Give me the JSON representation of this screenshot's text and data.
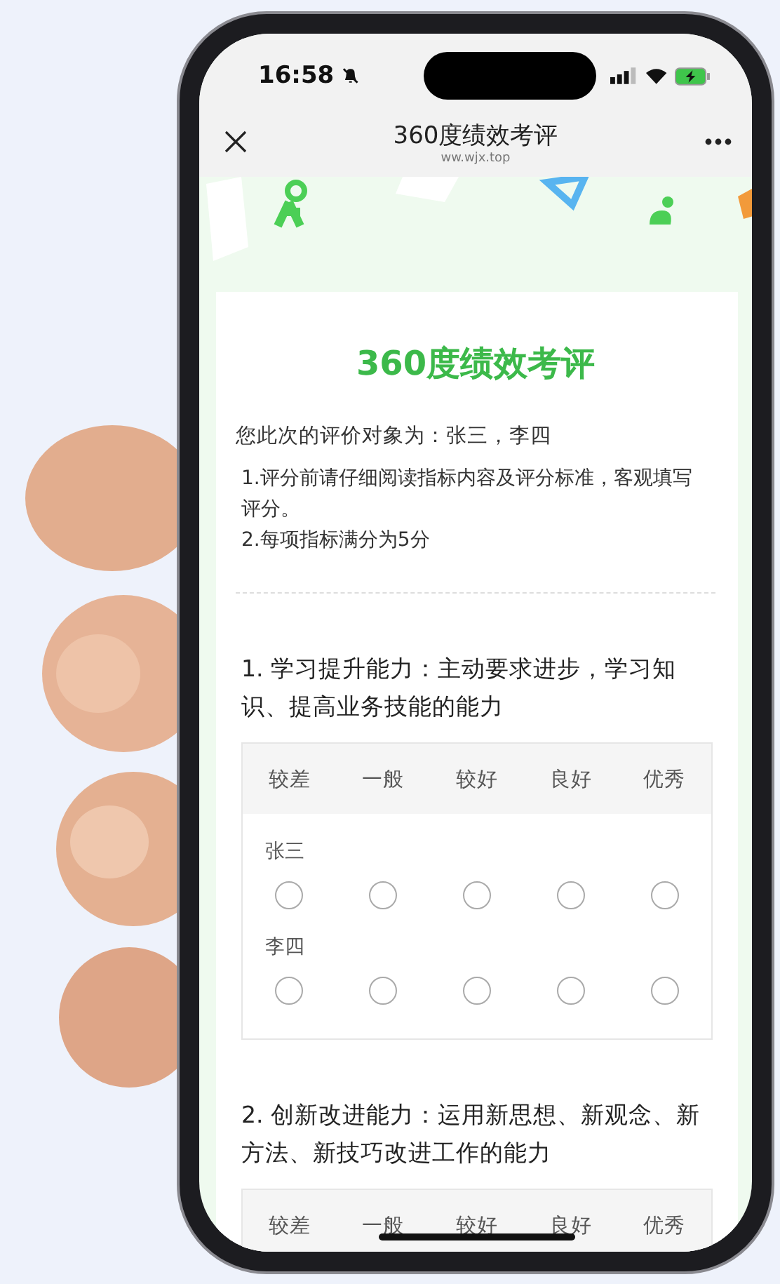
{
  "status_bar": {
    "time": "16:58"
  },
  "nav": {
    "title": "360度绩效考评",
    "subtitle": "ww.wjx.top"
  },
  "survey": {
    "title": "360度绩效考评",
    "intro": "您此次的评价对象为：张三，李四",
    "notes": [
      "1.评分前请仔细阅读指标内容及评分标准，客观填写评分。",
      "2.每项指标满分为5分"
    ],
    "questions": [
      {
        "title": "1. 学习提升能力：主动要求进步，学习知识、提高业务技能的能力",
        "scale": [
          "较差",
          "一般",
          "较好",
          "良好",
          "优秀"
        ],
        "rows": [
          {
            "label": "张三",
            "choices": [
              {
                "selected": false
              },
              {
                "selected": false
              },
              {
                "selected": false
              },
              {
                "selected": false
              },
              {
                "selected": false
              }
            ]
          },
          {
            "label": "李四",
            "choices": [
              {
                "selected": false
              },
              {
                "selected": false
              },
              {
                "selected": false
              },
              {
                "selected": false
              },
              {
                "selected": false
              }
            ]
          }
        ]
      },
      {
        "title": "2. 创新改进能力：运用新思想、新观念、新方法、新技巧改进工作的能力",
        "scale": [
          "较差",
          "一般",
          "较好",
          "良好",
          "优秀"
        ]
      }
    ]
  }
}
